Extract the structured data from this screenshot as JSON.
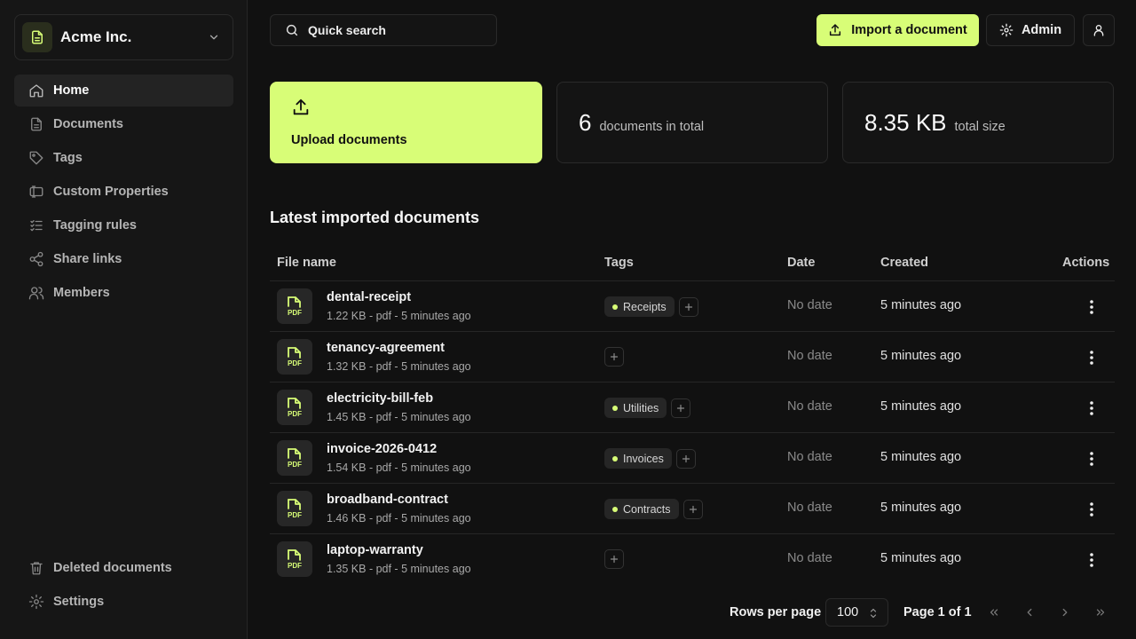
{
  "org": {
    "name": "Acme Inc.",
    "logo_icon": "document-icon"
  },
  "sidebar": {
    "items": [
      {
        "label": "Home",
        "icon": "home-icon",
        "active": true
      },
      {
        "label": "Documents",
        "icon": "document-icon"
      },
      {
        "label": "Tags",
        "icon": "tag-icon"
      },
      {
        "label": "Custom Properties",
        "icon": "properties-icon"
      },
      {
        "label": "Tagging rules",
        "icon": "list-check-icon"
      },
      {
        "label": "Share links",
        "icon": "share-icon"
      },
      {
        "label": "Members",
        "icon": "users-icon"
      }
    ],
    "bottom_items": [
      {
        "label": "Deleted documents",
        "icon": "trash-icon"
      },
      {
        "label": "Settings",
        "icon": "gear-icon"
      }
    ]
  },
  "header": {
    "search_label": "Quick search",
    "import_label": "Import a document",
    "admin_label": "Admin"
  },
  "stats": {
    "upload_label": "Upload documents",
    "count_value": "6",
    "count_label": "documents in total",
    "size_value": "8.35 KB",
    "size_label": "total size"
  },
  "section": {
    "title": "Latest imported documents"
  },
  "table": {
    "columns": {
      "file_name": "File name",
      "tags": "Tags",
      "date": "Date",
      "created": "Created",
      "actions": "Actions"
    },
    "rows": [
      {
        "name": "dental-receipt",
        "meta": "1.22 KB - pdf - 5 minutes ago",
        "tags": [
          "Receipts"
        ],
        "date": "No date",
        "created": "5 minutes ago"
      },
      {
        "name": "tenancy-agreement",
        "meta": "1.32 KB - pdf - 5 minutes ago",
        "tags": [],
        "date": "No date",
        "created": "5 minutes ago"
      },
      {
        "name": "electricity-bill-feb",
        "meta": "1.45 KB - pdf - 5 minutes ago",
        "tags": [
          "Utilities"
        ],
        "date": "No date",
        "created": "5 minutes ago"
      },
      {
        "name": "invoice-2026-0412",
        "meta": "1.54 KB - pdf - 5 minutes ago",
        "tags": [
          "Invoices"
        ],
        "date": "No date",
        "created": "5 minutes ago"
      },
      {
        "name": "broadband-contract",
        "meta": "1.46 KB - pdf - 5 minutes ago",
        "tags": [
          "Contracts"
        ],
        "date": "No date",
        "created": "5 minutes ago"
      },
      {
        "name": "laptop-warranty",
        "meta": "1.35 KB - pdf - 5 minutes ago",
        "tags": [],
        "date": "No date",
        "created": "5 minutes ago"
      }
    ]
  },
  "pagination": {
    "rows_per_page_label": "Rows per page",
    "rows_per_page_value": "100",
    "page_info": "Page 1 of 1"
  },
  "colors": {
    "accent": "#d8fd77",
    "background": "#111111",
    "sidebar": "#161616"
  }
}
